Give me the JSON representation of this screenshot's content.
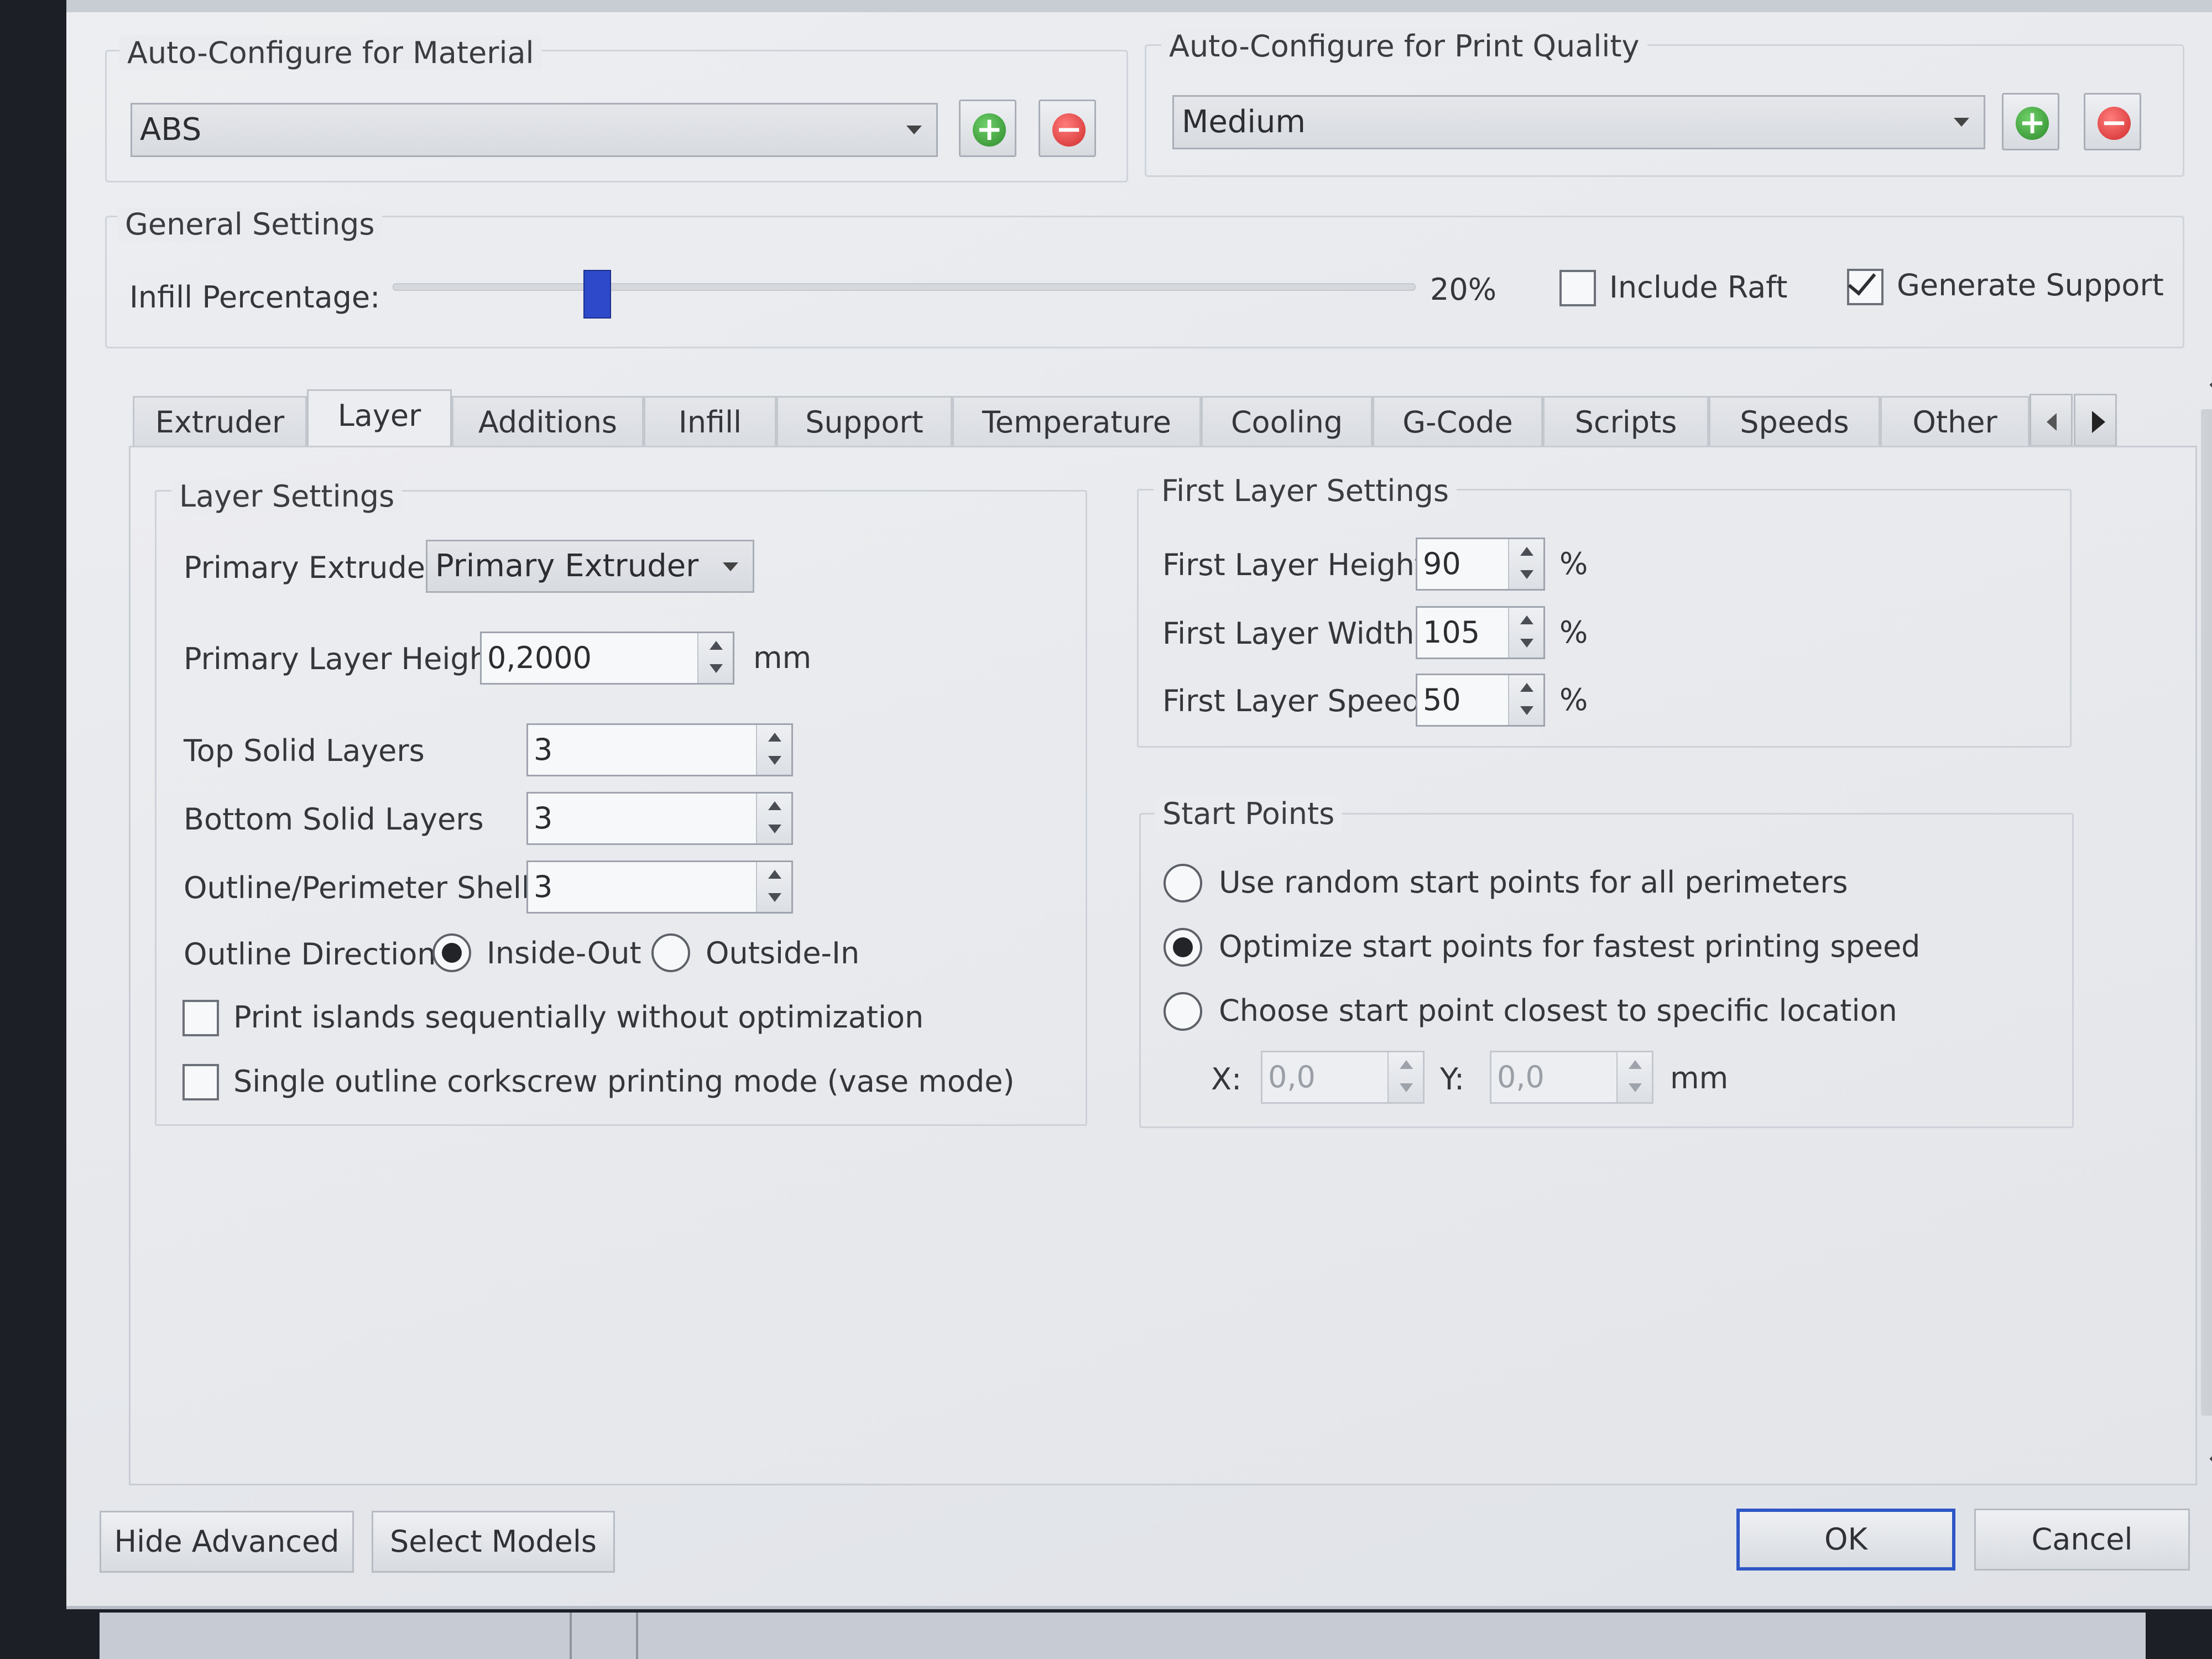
{
  "material": {
    "legend": "Auto-Configure for Material",
    "value": "ABS"
  },
  "quality": {
    "legend": "Auto-Configure for Print Quality",
    "value": "Medium"
  },
  "general": {
    "legend": "General Settings",
    "infill_label": "Infill Percentage:",
    "infill_value": "20%",
    "infill_fraction": 0.2,
    "include_raft_label": "Include Raft",
    "include_raft_checked": false,
    "generate_support_label": "Generate Support",
    "generate_support_checked": true
  },
  "tabs": [
    {
      "label": "Extruder",
      "active": false
    },
    {
      "label": "Layer",
      "active": true
    },
    {
      "label": "Additions",
      "active": false
    },
    {
      "label": "Infill",
      "active": false
    },
    {
      "label": "Support",
      "active": false
    },
    {
      "label": "Temperature",
      "active": false
    },
    {
      "label": "Cooling",
      "active": false
    },
    {
      "label": "G-Code",
      "active": false
    },
    {
      "label": "Scripts",
      "active": false
    },
    {
      "label": "Speeds",
      "active": false
    },
    {
      "label": "Other",
      "active": false
    }
  ],
  "layer": {
    "legend": "Layer Settings",
    "primary_extruder_label": "Primary Extruder",
    "primary_extruder_value": "Primary Extruder",
    "primary_layer_height_label": "Primary Layer Height",
    "primary_layer_height_value": "0,2000",
    "primary_layer_height_unit": "mm",
    "top_solid_layers_label": "Top Solid Layers",
    "top_solid_layers_value": "3",
    "bottom_solid_layers_label": "Bottom Solid Layers",
    "bottom_solid_layers_value": "3",
    "perimeter_shells_label": "Outline/Perimeter Shells",
    "perimeter_shells_value": "3",
    "outline_direction_label": "Outline Direction:",
    "inside_out_label": "Inside-Out",
    "outside_in_label": "Outside-In",
    "outline_direction_selected": "Inside-Out",
    "print_islands_label": "Print islands sequentially without optimization",
    "print_islands_checked": false,
    "vase_mode_label": "Single outline corkscrew printing mode (vase mode)",
    "vase_mode_checked": false
  },
  "first_layer": {
    "legend": "First Layer Settings",
    "height_label": "First Layer Height",
    "height_value": "90",
    "width_label": "First Layer Width",
    "width_value": "105",
    "speed_label": "First Layer Speed",
    "speed_value": "50",
    "unit": "%"
  },
  "start_points": {
    "legend": "Start Points",
    "random_label": "Use random start points for all perimeters",
    "optimize_label": "Optimize start points for fastest printing speed",
    "closest_label": "Choose start point closest to specific location",
    "selected": "Optimize start points for fastest printing speed",
    "x_label": "X:",
    "x_value": "0,0",
    "y_label": "Y:",
    "y_value": "0,0",
    "unit": "mm"
  },
  "footer": {
    "hide_advanced": "Hide Advanced",
    "select_models": "Select Models",
    "ok": "OK",
    "cancel": "Cancel"
  },
  "colors": {
    "slider_thumb": "#2e49c9",
    "ok_border": "#2d57c6",
    "add_icon": "#2d8a2a",
    "remove_icon": "#d12b2b"
  },
  "icons": {
    "add": "plus-circle-icon",
    "remove": "minus-circle-icon"
  }
}
